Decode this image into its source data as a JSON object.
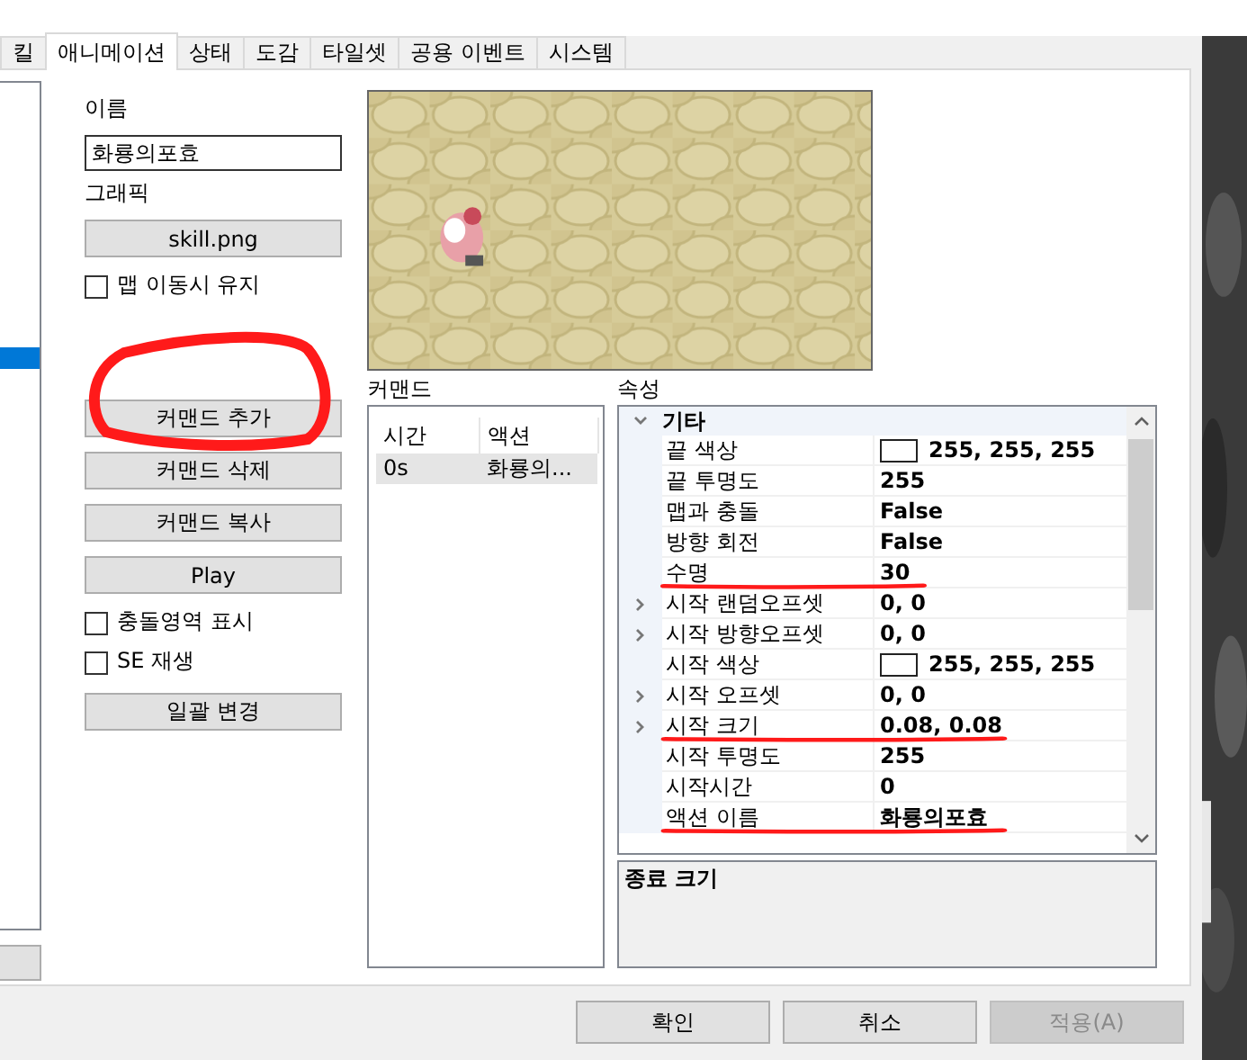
{
  "tabs": [
    {
      "label": "킬",
      "selected": false
    },
    {
      "label": "애니메이션",
      "selected": true
    },
    {
      "label": "상태",
      "selected": false
    },
    {
      "label": "도감",
      "selected": false
    },
    {
      "label": "타일셋",
      "selected": false
    },
    {
      "label": "공용 이벤트",
      "selected": false
    },
    {
      "label": "시스템",
      "selected": false
    }
  ],
  "name_label": "이름",
  "name_value": "화룡의포효",
  "graphic_label": "그래픽",
  "graphic_button": "skill.png",
  "keep_on_map_move": {
    "label": "맵 이동시 유지",
    "checked": false
  },
  "command_buttons": [
    {
      "label": "커맨드 추가",
      "circled": true
    },
    {
      "label": "커맨드 삭제",
      "circled": false
    },
    {
      "label": "커맨드 복사",
      "circled": false
    },
    {
      "label": "Play",
      "circled": false
    }
  ],
  "options": [
    {
      "label": "충돌영역 표시",
      "checked": false
    },
    {
      "label": "SE 재생",
      "checked": false
    }
  ],
  "batch_button": "일괄 변경",
  "commands": {
    "label": "커맨드",
    "columns": [
      "시간",
      "액션"
    ],
    "rows": [
      {
        "cells": [
          "0s",
          "화룡의..."
        ],
        "selected": true
      }
    ]
  },
  "properties": {
    "label": "속성",
    "category": {
      "label": "기타",
      "expanded": true
    },
    "rows": [
      {
        "name": "끝 색상",
        "value": "255, 255, 255",
        "kind": "color",
        "expandable": false,
        "underlined": false
      },
      {
        "name": "끝 투명도",
        "value": "255",
        "kind": "text",
        "expandable": false,
        "underlined": false
      },
      {
        "name": "맵과 충돌",
        "value": "False",
        "kind": "text",
        "expandable": false,
        "underlined": false
      },
      {
        "name": "방향 회전",
        "value": "False",
        "kind": "text",
        "expandable": false,
        "underlined": false
      },
      {
        "name": "수명",
        "value": "30",
        "kind": "text",
        "expandable": false,
        "underlined": true
      },
      {
        "name": "시작 랜덤오프셋",
        "value": "0, 0",
        "kind": "text",
        "expandable": true,
        "underlined": false
      },
      {
        "name": "시작 방향오프셋",
        "value": "0, 0",
        "kind": "text",
        "expandable": true,
        "underlined": false
      },
      {
        "name": "시작 색상",
        "value": "255, 255, 255",
        "kind": "color",
        "expandable": false,
        "underlined": false
      },
      {
        "name": "시작 오프셋",
        "value": "0, 0",
        "kind": "text",
        "expandable": true,
        "underlined": false
      },
      {
        "name": "시작 크기",
        "value": "0.08, 0.08",
        "kind": "text",
        "expandable": true,
        "underlined": true
      },
      {
        "name": "시작 투명도",
        "value": "255",
        "kind": "text",
        "expandable": false,
        "underlined": false
      },
      {
        "name": "시작시간",
        "value": "0",
        "kind": "text",
        "expandable": false,
        "underlined": false
      },
      {
        "name": "액션 이름",
        "value": "화룡의포효",
        "kind": "text",
        "expandable": false,
        "underlined": true
      }
    ]
  },
  "description": "종료 크기",
  "dialog_buttons": [
    {
      "label": "확인",
      "disabled": false
    },
    {
      "label": "취소",
      "disabled": false
    },
    {
      "label": "적용(A)",
      "disabled": true
    }
  ]
}
